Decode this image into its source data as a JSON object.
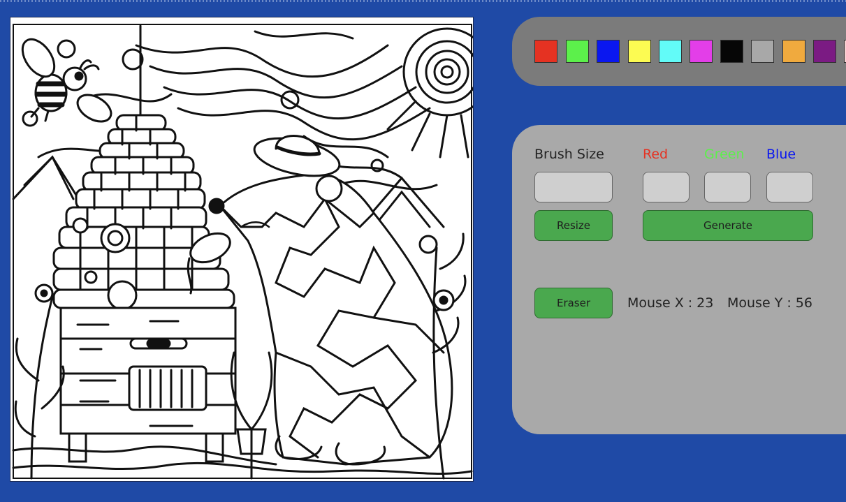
{
  "palette": {
    "swatches": [
      {
        "name": "red-swatch",
        "color": "#e53222"
      },
      {
        "name": "green-swatch",
        "color": "#5cf04b"
      },
      {
        "name": "blue-swatch",
        "color": "#0a17f0"
      },
      {
        "name": "yellow-swatch",
        "color": "#fcfb52"
      },
      {
        "name": "cyan-swatch",
        "color": "#62fbf8"
      },
      {
        "name": "magenta-swatch",
        "color": "#e33ee8"
      },
      {
        "name": "black-swatch",
        "color": "#060606"
      },
      {
        "name": "gray-swatch",
        "color": "#a8a8a8"
      },
      {
        "name": "orange-swatch",
        "color": "#f0aa3e"
      },
      {
        "name": "purple-swatch",
        "color": "#7b1b83"
      },
      {
        "name": "pink-swatch",
        "color": "#f6d2d2"
      }
    ]
  },
  "controls": {
    "brush_size_label": "Brush Size",
    "red_label": "Red",
    "green_label": "Green",
    "blue_label": "Blue",
    "red_color": "#e53222",
    "green_color": "#5cf04b",
    "blue_color": "#0a17f0",
    "brush_size_value": "",
    "red_value": "",
    "green_value": "",
    "blue_value": "",
    "resize_label": "Resize",
    "generate_label": "Generate",
    "eraser_label": "Eraser",
    "mouse_x_label": "Mouse X : 23",
    "mouse_y_label": "Mouse Y : 56"
  },
  "canvas": {
    "image": "coloring-page-bear-beehive"
  }
}
